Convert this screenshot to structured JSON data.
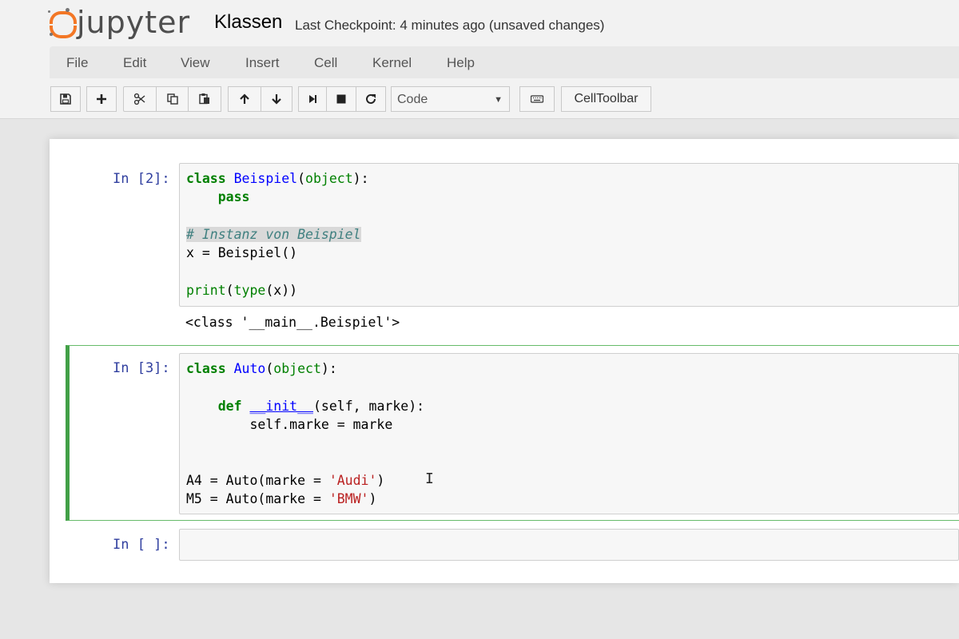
{
  "header": {
    "logo_text": "jupyter",
    "notebook_name": "Klassen",
    "checkpoint": "Last Checkpoint: 4 minutes ago (unsaved changes)"
  },
  "menubar": {
    "items": [
      "File",
      "Edit",
      "View",
      "Insert",
      "Cell",
      "Kernel",
      "Help"
    ]
  },
  "toolbar": {
    "icons": [
      "save-icon",
      "plus-icon",
      "scissors-icon",
      "copy-icon",
      "paste-icon",
      "arrow-up-icon",
      "arrow-down-icon",
      "step-forward-icon",
      "stop-icon",
      "restart-icon",
      "keyboard-icon"
    ],
    "cell_type": "Code",
    "celltoolbar_label": "CellToolbar"
  },
  "cells": [
    {
      "prompt": "In [2]:",
      "lines": [
        "class Beispiel(object):",
        "    pass",
        "",
        "# Instanz von Beispiel",
        "x = Beispiel()",
        "",
        "print(type(x))"
      ],
      "output": "<class '__main__.Beispiel'>"
    },
    {
      "prompt": "In [3]:",
      "lines": [
        "class Auto(object):",
        "",
        "    def __init__(self, marke):",
        "        self.marke = marke",
        "",
        "",
        "A4 = Auto(marke = 'Audi')",
        "M5 = Auto(marke = 'BMW')"
      ],
      "selected": true
    },
    {
      "prompt": "In [ ]:",
      "lines": []
    }
  ],
  "colors": {
    "logo_orange": "#f37726",
    "prompt_blue": "#303f9f",
    "keyword_green": "#008000",
    "class_name_blue": "#0000ff",
    "string_red": "#ba2121",
    "comment_teal": "#408080",
    "selected_cell_green": "#42a047"
  }
}
